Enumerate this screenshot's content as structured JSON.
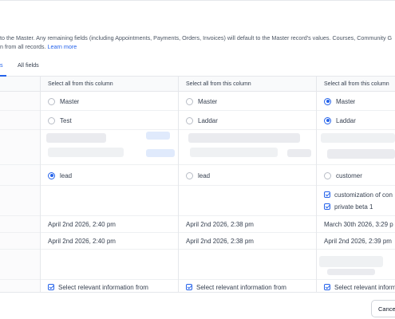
{
  "intro": {
    "line1": "to the Master. Any remaining fields (including Appointments, Payments, Orders, Invoices) will default to the Master record's values. Courses, Community G",
    "line2_prefix": "n from all records.",
    "learn_more": "Learn more"
  },
  "tabs": [
    {
      "label": "s"
    },
    {
      "label": "All fields"
    }
  ],
  "columns": [
    {
      "header": "Select all from this column"
    },
    {
      "header": "Select all from this column"
    },
    {
      "header": "Select all from this column"
    }
  ],
  "rows": {
    "record_type": [
      "Master",
      "Master",
      "Master"
    ],
    "name": [
      "Test",
      "Laddar",
      "Laddar"
    ],
    "stage": [
      "lead",
      "lead",
      "customer"
    ],
    "tags": [
      "customization of con",
      "private beta 1"
    ],
    "created": [
      "April 2nd 2026, 2:40 pm",
      "April 2nd 2026, 2:38 pm",
      "March 30th 2026, 3:29 p"
    ],
    "updated": [
      "April 2nd 2026, 2:40 pm",
      "April 2nd 2026, 2:38 pm",
      "April 2nd 2026, 2:39 pm"
    ],
    "select_relevant": [
      "Select relevant information from",
      "Select relevant information from",
      "Select relevant inform"
    ]
  },
  "footer": {
    "cancel_label": "Cancel"
  }
}
